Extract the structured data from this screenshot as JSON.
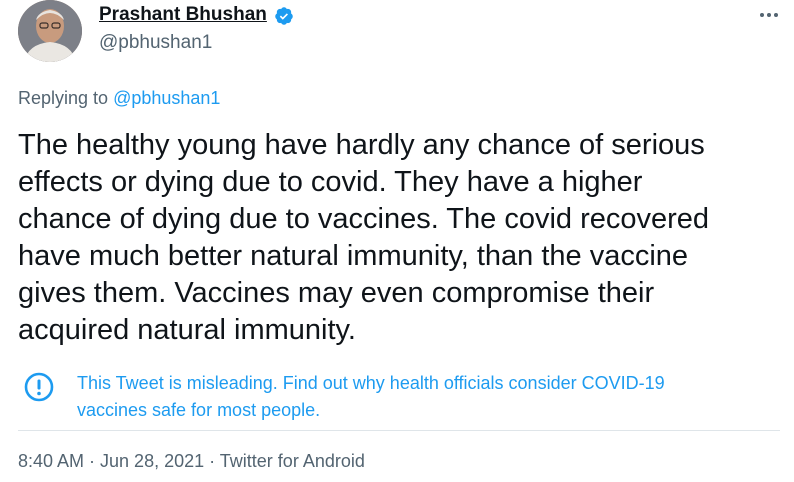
{
  "author": {
    "name": "Prashant Bhushan",
    "handle": "@pbhushan1",
    "verified": true
  },
  "reply": {
    "prefix": "Replying to",
    "mention": "@pbhushan1"
  },
  "tweet_lines": [
    "The healthy young have hardly any chance of serious",
    "effects or dying due to covid. They have a higher",
    "chance of dying due to vaccines. The covid recovered",
    "have much better natural immunity, than the vaccine",
    "gives them. Vaccines may even compromise their",
    "acquired natural immunity."
  ],
  "warning": {
    "icon": "exclamation-circle-icon",
    "lines": [
      "This Tweet is misleading. Find out why health officials consider COVID-19",
      "vaccines safe for most people."
    ]
  },
  "meta": {
    "text": "8:40 AM · Jun 28, 2021 · Twitter for Android"
  },
  "colors": {
    "link": "#1d9bf0",
    "secondary": "#536471",
    "primary": "#0f1419",
    "verified": "#1d9bf0"
  }
}
